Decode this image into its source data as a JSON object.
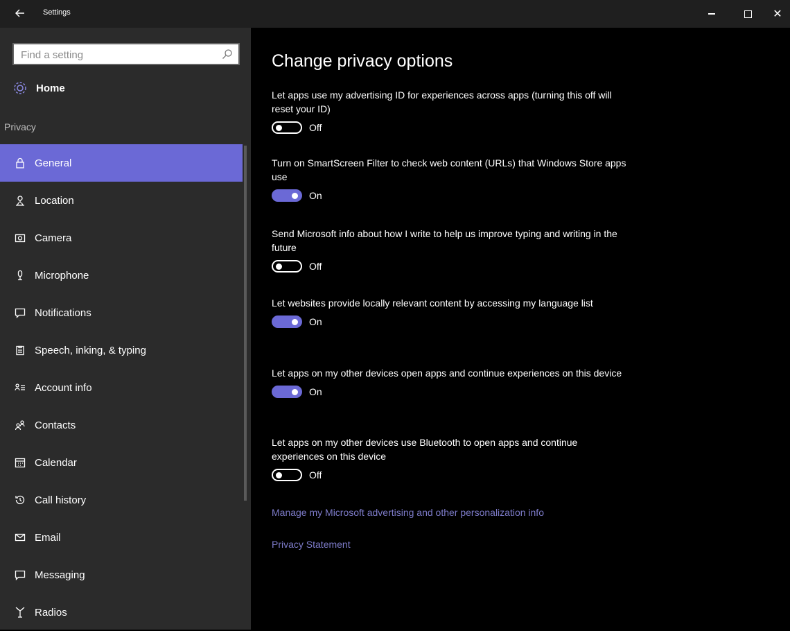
{
  "window": {
    "title": "Settings",
    "back_icon": "back-arrow-icon",
    "minimize_icon": "minimize-icon",
    "maximize_icon": "maximize-icon",
    "close_glyph": "✕"
  },
  "sidebar": {
    "search_placeholder": "Find a setting",
    "home_label": "Home",
    "section_title": "Privacy",
    "items": [
      {
        "label": "General",
        "icon": "lock-icon",
        "active": true
      },
      {
        "label": "Location",
        "icon": "location-icon"
      },
      {
        "label": "Camera",
        "icon": "camera-icon"
      },
      {
        "label": "Microphone",
        "icon": "microphone-icon"
      },
      {
        "label": "Notifications",
        "icon": "notifications-icon"
      },
      {
        "label": "Speech, inking, & typing",
        "icon": "clipboard-icon"
      },
      {
        "label": "Account info",
        "icon": "account-info-icon"
      },
      {
        "label": "Contacts",
        "icon": "contacts-icon"
      },
      {
        "label": "Calendar",
        "icon": "calendar-icon"
      },
      {
        "label": "Call history",
        "icon": "history-icon"
      },
      {
        "label": "Email",
        "icon": "email-icon"
      },
      {
        "label": "Messaging",
        "icon": "messaging-icon"
      },
      {
        "label": "Radios",
        "icon": "radios-icon"
      }
    ]
  },
  "main": {
    "title": "Change privacy options",
    "settings": [
      {
        "desc": "Let apps use my advertising ID for experiences across apps (turning this off will reset your ID)",
        "state": "Off"
      },
      {
        "desc": "Turn on SmartScreen Filter to check web content (URLs) that Windows Store apps use",
        "state": "On"
      },
      {
        "desc": "Send Microsoft info about how I write to help us improve typing and writing in the future",
        "state": "Off"
      },
      {
        "desc": "Let websites provide locally relevant content by accessing my language list",
        "state": "On"
      },
      {
        "desc": "Let apps on my other devices open apps and continue experiences on this device",
        "state": "On"
      },
      {
        "desc": "Let apps on my other devices use Bluetooth to open apps and continue experiences on this device",
        "state": "Off"
      }
    ],
    "links": {
      "manage": "Manage my Microsoft advertising and other personalization info",
      "privacy_statement": "Privacy Statement"
    }
  },
  "colors": {
    "accent": "#6b69d6",
    "sidebar_bg": "#2b2b2b",
    "main_bg": "#000000",
    "link": "#7d7bc9"
  }
}
